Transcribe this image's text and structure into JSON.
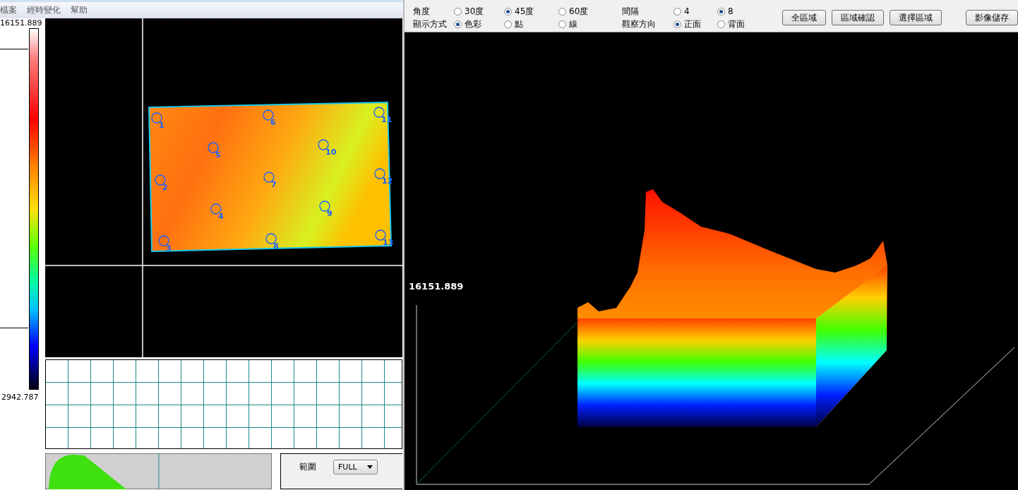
{
  "menu": [
    "檔案",
    "經時變化",
    "幫助"
  ],
  "color_scale": {
    "max": "16151.889",
    "min": "2942.787"
  },
  "image_markers": [
    "1",
    "2",
    "3",
    "4",
    "5",
    "6",
    "7",
    "8",
    "9",
    "10",
    "11",
    "12",
    "13"
  ],
  "range": {
    "label": "範圍",
    "value": "FULL"
  },
  "toolbar": {
    "groups": [
      {
        "label": "角度",
        "options": [
          {
            "label": "30度",
            "selected": false
          },
          {
            "label": "45度",
            "selected": true
          },
          {
            "label": "60度",
            "selected": false
          }
        ]
      },
      {
        "label": "顯示方式",
        "options": [
          {
            "label": "色彩",
            "selected": true
          },
          {
            "label": "點",
            "selected": false
          },
          {
            "label": "線",
            "selected": false
          }
        ]
      },
      {
        "label": "間隔",
        "options": [
          {
            "label": "4",
            "selected": false
          },
          {
            "label": "8",
            "selected": true
          }
        ]
      },
      {
        "label": "觀察方向",
        "options": [
          {
            "label": "正面",
            "selected": true
          },
          {
            "label": "背面",
            "selected": false
          }
        ]
      }
    ],
    "buttons": [
      "全區域",
      "區域確認",
      "選擇區域",
      "影像儲存"
    ]
  },
  "plot": {
    "max_label": "16151.889"
  }
}
